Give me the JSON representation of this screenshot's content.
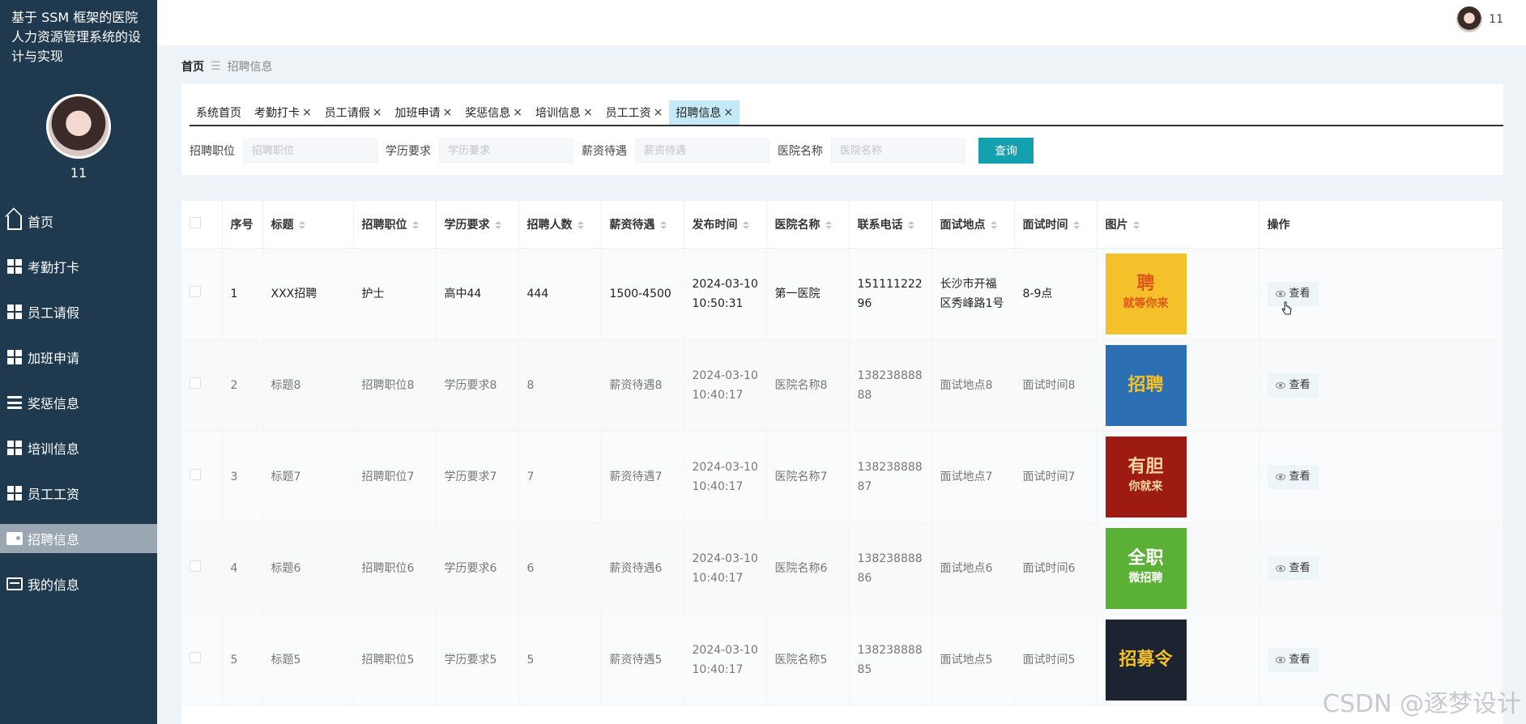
{
  "app": {
    "title": "基于 SSM 框架的医院人力资源管理系统的设计与实现",
    "username": "11"
  },
  "topbar": {
    "username": "11"
  },
  "sidebar": {
    "items": [
      {
        "label": "首页",
        "icon": "home-icon"
      },
      {
        "label": "考勤打卡",
        "icon": "grid-icon"
      },
      {
        "label": "员工请假",
        "icon": "grid-icon"
      },
      {
        "label": "加班申请",
        "icon": "grid-icon"
      },
      {
        "label": "奖惩信息",
        "icon": "list-icon"
      },
      {
        "label": "培训信息",
        "icon": "grid-icon"
      },
      {
        "label": "员工工资",
        "icon": "grid-icon"
      },
      {
        "label": "招聘信息",
        "icon": "wallet-icon",
        "active": true
      },
      {
        "label": "我的信息",
        "icon": "card-icon"
      }
    ]
  },
  "breadcrumb": {
    "home": "首页",
    "separator": "☰",
    "current": "招聘信息"
  },
  "tabs": [
    {
      "label": "系统首页",
      "closable": false
    },
    {
      "label": "考勤打卡",
      "closable": true
    },
    {
      "label": "员工请假",
      "closable": true
    },
    {
      "label": "加班申请",
      "closable": true
    },
    {
      "label": "奖惩信息",
      "closable": true
    },
    {
      "label": "培训信息",
      "closable": true
    },
    {
      "label": "员工工资",
      "closable": true
    },
    {
      "label": "招聘信息",
      "closable": true,
      "active": true
    }
  ],
  "tab_close": "×",
  "search": {
    "fields": [
      {
        "label": "招聘职位",
        "placeholder": "招聘职位",
        "value": ""
      },
      {
        "label": "学历要求",
        "placeholder": "学历要求",
        "value": ""
      },
      {
        "label": "薪资待遇",
        "placeholder": "薪资待遇",
        "value": ""
      },
      {
        "label": "医院名称",
        "placeholder": "医院名称",
        "value": ""
      }
    ],
    "button": "查询"
  },
  "table": {
    "headers": [
      "序号",
      "标题",
      "招聘职位",
      "学历要求",
      "招聘人数",
      "薪资待遇",
      "发布时间",
      "医院名称",
      "联系电话",
      "面试地点",
      "面试时间",
      "图片",
      "操作"
    ],
    "sortable": [
      false,
      true,
      true,
      true,
      true,
      true,
      true,
      true,
      true,
      true,
      true,
      true,
      false
    ],
    "view_label": "查看",
    "rows": [
      {
        "no": "1",
        "title": "XXX招聘",
        "position": "护士",
        "education": "高中44",
        "count": "444",
        "salary": "1500-4500",
        "date": "2024-03-10",
        "time": "10:50:31",
        "hospital": "第一医院",
        "phone1": "151111222",
        "phone2": "96",
        "place1": "长沙市开福",
        "place2": "区秀峰路1号",
        "interview": "8-9点",
        "image": {
          "text1": "聘",
          "text2": "就等你来",
          "bg": "#f4c12a",
          "fg": "#e1531b"
        }
      },
      {
        "no": "2",
        "title": "标题8",
        "position": "招聘职位8",
        "education": "学历要求8",
        "count": "8",
        "salary": "薪资待遇8",
        "date": "2024-03-10",
        "time": "10:40:17",
        "hospital": "医院名称8",
        "phone1": "138238888",
        "phone2": "88",
        "place1": "面试地点8",
        "place2": "",
        "interview": "面试时间8",
        "image": {
          "text1": "招聘",
          "text2": "",
          "bg": "#2d6fb3",
          "fg": "#f4c12a"
        }
      },
      {
        "no": "3",
        "title": "标题7",
        "position": "招聘职位7",
        "education": "学历要求7",
        "count": "7",
        "salary": "薪资待遇7",
        "date": "2024-03-10",
        "time": "10:40:17",
        "hospital": "医院名称7",
        "phone1": "138238888",
        "phone2": "87",
        "place1": "面试地点7",
        "place2": "",
        "interview": "面试时间7",
        "image": {
          "text1": "有胆",
          "text2": "你就来",
          "bg": "#9e1b14",
          "fg": "#f5d6a0"
        }
      },
      {
        "no": "4",
        "title": "标题6",
        "position": "招聘职位6",
        "education": "学历要求6",
        "count": "6",
        "salary": "薪资待遇6",
        "date": "2024-03-10",
        "time": "10:40:17",
        "hospital": "医院名称6",
        "phone1": "138238888",
        "phone2": "86",
        "place1": "面试地点6",
        "place2": "",
        "interview": "面试时间6",
        "image": {
          "text1": "全职",
          "text2": "微招聘",
          "bg": "#5bb135",
          "fg": "#ffffff"
        }
      },
      {
        "no": "5",
        "title": "标题5",
        "position": "招聘职位5",
        "education": "学历要求5",
        "count": "5",
        "salary": "薪资待遇5",
        "date": "2024-03-10",
        "time": "10:40:17",
        "hospital": "医院名称5",
        "phone1": "138238888",
        "phone2": "85",
        "place1": "面试地点5",
        "place2": "",
        "interview": "面试时间5",
        "image": {
          "text1": "招募令",
          "text2": "",
          "bg": "#1b2430",
          "fg": "#f4c12a"
        }
      }
    ]
  },
  "watermark": "CSDN @逐梦设计"
}
